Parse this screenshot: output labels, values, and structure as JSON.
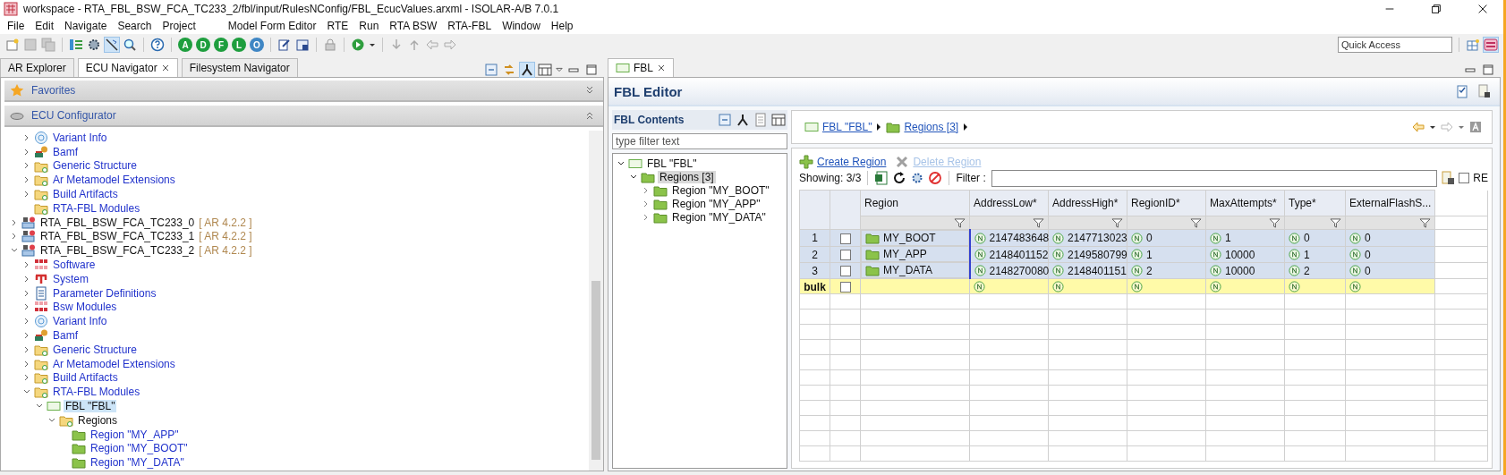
{
  "window": {
    "title": "workspace - RTA_FBL_BSW_FCA_TC233_2/fbl/input/RulesNConfig/FBL_EcucValues.arxml - ISOLAR-A/B 7.0.1"
  },
  "menu": [
    "File",
    "Edit",
    "Navigate",
    "Search",
    "Project",
    "Model Form Editor",
    "RTE",
    "Run",
    "RTA BSW",
    "RTA-FBL",
    "Window",
    "Help"
  ],
  "toolbar": {
    "badges": [
      {
        "label": "A",
        "color": "#1e9e3e"
      },
      {
        "label": "D",
        "color": "#1e9e3e"
      },
      {
        "label": "F",
        "color": "#1e9e3e"
      },
      {
        "label": "L",
        "color": "#1e9e3e"
      },
      {
        "label": "O",
        "color": "#3f86c4"
      }
    ],
    "quick_access": {
      "placeholder": "Quick Access"
    }
  },
  "left_tabs": [
    {
      "label": "AR Explorer",
      "selected": false
    },
    {
      "label": "ECU Navigator",
      "selected": true
    },
    {
      "label": "Filesystem Navigator",
      "selected": false
    }
  ],
  "favorites": {
    "title": "Favorites"
  },
  "ecu_configurator": {
    "title": "ECU Configurator"
  },
  "tree": {
    "partial_items": [
      {
        "label": "Variant Info",
        "kind": "variant",
        "expanded": false,
        "selected": false
      },
      {
        "label": "Bamf",
        "kind": "bamf",
        "expanded": false,
        "selected": false
      },
      {
        "label": "Generic Structure",
        "kind": "folder",
        "expanded": false,
        "selected": false
      },
      {
        "label": "Ar Metamodel Extensions",
        "kind": "folder",
        "expanded": false,
        "selected": false
      },
      {
        "label": "Build Artifacts",
        "kind": "folder",
        "expanded": false,
        "selected": false
      },
      {
        "label": "RTA-FBL Modules",
        "kind": "folder",
        "selected": false
      }
    ],
    "items": [
      {
        "label": "RTA_FBL_BSW_FCA_TC233_0",
        "suffix": "[ AR 4.2.2 ]",
        "kind": "project",
        "expanded": false,
        "selected": false
      },
      {
        "label": "RTA_FBL_BSW_FCA_TC233_1",
        "suffix": "[ AR 4.2.2 ]",
        "kind": "project",
        "expanded": false,
        "selected": false
      },
      {
        "label": "RTA_FBL_BSW_FCA_TC233_2",
        "suffix": "[ AR 4.2.2 ]",
        "kind": "project",
        "expanded": true,
        "selected": false,
        "children": [
          {
            "label": "Software",
            "kind": "software",
            "expanded": false,
            "selected": false
          },
          {
            "label": "System",
            "kind": "system",
            "expanded": false,
            "selected": false
          },
          {
            "label": "Parameter Definitions",
            "kind": "paramdef",
            "expanded": false,
            "selected": false
          },
          {
            "label": "Bsw Modules",
            "kind": "bsw",
            "expanded": false,
            "selected": false
          },
          {
            "label": "Variant Info",
            "kind": "variant",
            "expanded": false,
            "selected": false
          },
          {
            "label": "Bamf",
            "kind": "bamf",
            "expanded": false,
            "selected": false
          },
          {
            "label": "Generic Structure",
            "kind": "folder",
            "expanded": false,
            "selected": false
          },
          {
            "label": "Ar Metamodel Extensions",
            "kind": "folder",
            "expanded": false,
            "selected": false
          },
          {
            "label": "Build Artifacts",
            "kind": "folder",
            "expanded": false,
            "selected": false
          },
          {
            "label": "RTA-FBL Modules",
            "kind": "folder",
            "expanded": true,
            "selected": false,
            "children": [
              {
                "label": "FBL \"FBL\"",
                "kind": "fbl",
                "expanded": true,
                "selected": true,
                "children": [
                  {
                    "label": "Regions",
                    "kind": "container",
                    "expanded": true,
                    "selected": false,
                    "children": [
                      {
                        "label": "Region \"MY_APP\"",
                        "kind": "region",
                        "selected": false
                      },
                      {
                        "label": "Region \"MY_BOOT\"",
                        "kind": "region",
                        "selected": false
                      },
                      {
                        "label": "Region \"MY_DATA\"",
                        "kind": "region",
                        "selected": false
                      }
                    ]
                  }
                ]
              }
            ]
          }
        ]
      }
    ]
  },
  "editor_tab": {
    "label": "FBL"
  },
  "editor": {
    "title": "FBL Editor",
    "contents": {
      "title": "FBL Contents",
      "filter": {
        "placeholder": "type filter text"
      },
      "tree": [
        {
          "label": "FBL \"FBL\"",
          "kind": "fbl",
          "expanded": true,
          "selected": false,
          "children": [
            {
              "label": "Regions [3]",
              "kind": "region",
              "expanded": true,
              "selected": true,
              "children": [
                {
                  "label": "Region \"MY_BOOT\"",
                  "kind": "region",
                  "expanded": false,
                  "selected": false
                },
                {
                  "label": "Region \"MY_APP\"",
                  "kind": "region",
                  "expanded": false,
                  "selected": false
                },
                {
                  "label": "Region \"MY_DATA\"",
                  "kind": "region",
                  "expanded": false,
                  "selected": false
                }
              ]
            }
          ]
        }
      ]
    },
    "breadcrumb": [
      {
        "label": "FBL \"FBL\"",
        "kind": "fbl"
      },
      {
        "label": "Regions [3]",
        "kind": "region"
      }
    ],
    "actions": [
      {
        "label": "Create Region",
        "kind": "add",
        "disabled": false
      },
      {
        "label": "Delete Region",
        "kind": "delete",
        "disabled": true
      }
    ],
    "showing": "Showing: 3/3",
    "filter": {
      "label": "Filter :"
    },
    "re": {
      "label": "RE",
      "checked": false
    },
    "table": {
      "columns": [
        "Region",
        "AddressLow*",
        "AddressHigh*",
        "RegionID*",
        "MaxAttempts*",
        "Type*",
        "ExternalFlashS..."
      ],
      "rows": [
        {
          "number": "1",
          "checked": false,
          "region": "MY_BOOT",
          "values": [
            "2147483648",
            "2147713023",
            "0",
            "1",
            "0",
            "0"
          ]
        },
        {
          "number": "2",
          "checked": false,
          "region": "MY_APP",
          "values": [
            "2148401152",
            "2149580799",
            "1",
            "10000",
            "1",
            "0"
          ]
        },
        {
          "number": "3",
          "checked": false,
          "region": "MY_DATA",
          "values": [
            "2148270080",
            "2148401151",
            "2",
            "10000",
            "2",
            "0"
          ]
        }
      ],
      "bulk": {
        "label": "bulk",
        "checked": false
      }
    }
  }
}
